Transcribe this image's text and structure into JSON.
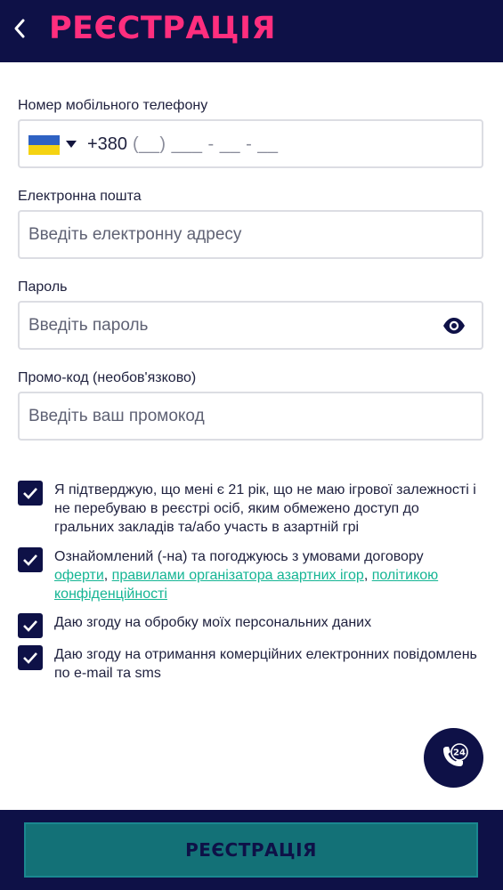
{
  "header": {
    "back_icon": "chevron-left-icon",
    "title": "РЕЄСТРАЦІЯ"
  },
  "form": {
    "phone": {
      "label": "Номер мобільного телефону",
      "country_icon": "ukraine-flag-icon",
      "prefix": "+380",
      "mask": "(__) ___ - __ - __"
    },
    "email": {
      "label": "Електронна пошта",
      "placeholder": "Введіть електронну адресу"
    },
    "password": {
      "label": "Пароль",
      "placeholder": "Введіть пароль",
      "toggle_icon": "eye-icon"
    },
    "promo": {
      "label": "Промо-код (необов'язково)",
      "placeholder": "Введіть ваш промокод"
    }
  },
  "agreements": [
    {
      "checked": true,
      "text": "Я підтверджую, що мені є 21 рік, що не маю ігрової залежності і не перебуваю в реєстрі осіб, яким обмежено доступ до гральних закладів та/або участь в азартній грі"
    },
    {
      "checked": true,
      "text": "Ознайомлений (-на) та погоджуюсь з умовами договору",
      "links": [
        "оферти",
        "правилами організатора азартних ігор",
        "політикою конфіденційності"
      ],
      "separator": ", "
    },
    {
      "checked": true,
      "text": "Даю згоду на обробку моїх персональних даних"
    },
    {
      "checked": true,
      "text": "Даю згоду на отримання комерційних електронних повідомлень по e-mail та sms"
    }
  ],
  "support": {
    "icon": "phone-24-icon",
    "badge": "24"
  },
  "footer": {
    "submit_label": "РЕЄСТРАЦІЯ"
  },
  "colors": {
    "navy": "#0e1147",
    "title_pink": "#ff2e7e",
    "link_green": "#15b594",
    "button_teal": "#137177"
  }
}
